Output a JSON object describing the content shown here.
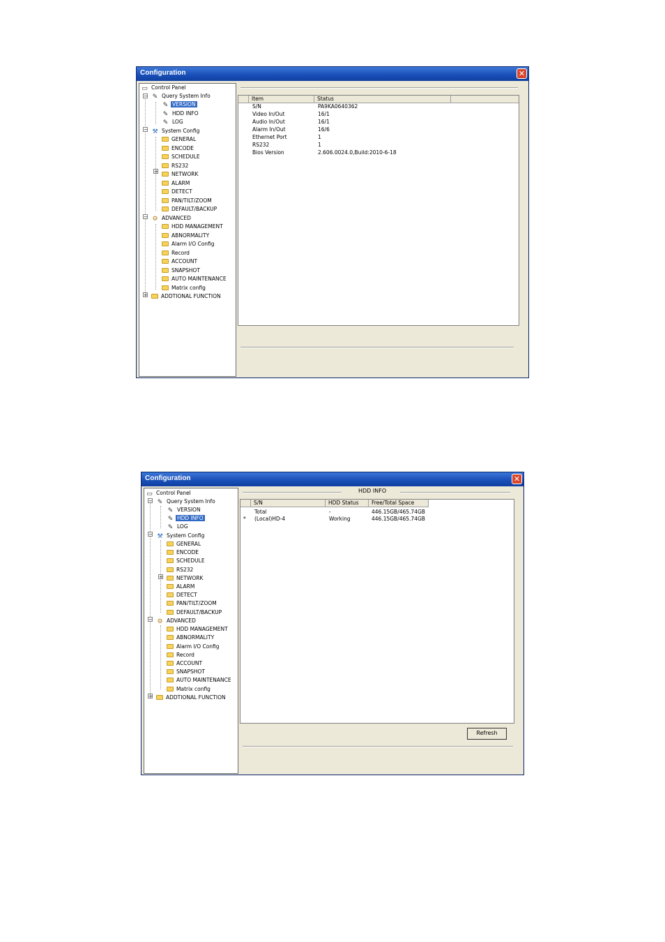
{
  "window_title": "Configuration",
  "close_glyph": "✕",
  "tree": {
    "control_panel": "Control Panel",
    "query_system_info": "Query System Info",
    "version": "VERSION",
    "hdd_info": "HDD INFO",
    "log": "LOG",
    "system_config": "System Config",
    "general": "GENERAL",
    "encode": "ENCODE",
    "schedule": "SCHEDULE",
    "rs232": "RS232",
    "network": "NETWORK",
    "alarm": "ALARM",
    "detect": "DETECT",
    "ptz": "PAN/TILT/ZOOM",
    "default_backup": "DEFAULT/BACKUP",
    "advanced": "ADVANCED",
    "hdd_management": "HDD MANAGEMENT",
    "abnormality": "ABNORMALITY",
    "alarm_io": "Alarm I/O Config",
    "record": "Record",
    "account": "ACCOUNT",
    "snapshot": "SNAPSHOT",
    "auto_maintenance": "AUTO MAINTENANCE",
    "matrix_config": "Matrix config",
    "additional": "ADDTIONAL FUNCTION"
  },
  "version_panel": {
    "columns": [
      "Item",
      "Status"
    ],
    "rows": [
      {
        "item": "S/N",
        "status": "PA9KA0640362"
      },
      {
        "item": "Video In/Out",
        "status": "16/1"
      },
      {
        "item": "Audio In/Out",
        "status": "16/1"
      },
      {
        "item": "Alarm In/Out",
        "status": "16/6"
      },
      {
        "item": "Ethernet Port",
        "status": "1"
      },
      {
        "item": "RS232",
        "status": "1"
      },
      {
        "item": "Bios Version",
        "status": "2.606.0024.0,Build:2010-6-18"
      }
    ]
  },
  "hdd_panel": {
    "title": "HDD INFO",
    "columns": [
      "S/N",
      "HDD Status",
      "Free/Total Space"
    ],
    "rows": [
      {
        "marker": "",
        "sn": "Total",
        "status": "-",
        "space": "446.15GB/465.74GB"
      },
      {
        "marker": "*",
        "sn": "(Local)HD-4",
        "status": "Working",
        "space": "446.15GB/465.74GB"
      }
    ],
    "refresh_label": "Refresh"
  }
}
